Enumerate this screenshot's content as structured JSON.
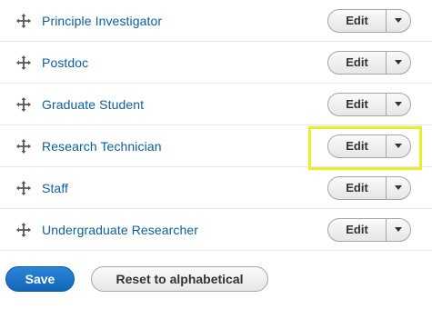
{
  "terms": [
    {
      "label": "Principle Investigator",
      "edit_label": "Edit"
    },
    {
      "label": "Postdoc",
      "edit_label": "Edit"
    },
    {
      "label": "Graduate Student",
      "edit_label": "Edit"
    },
    {
      "label": "Research Technician",
      "edit_label": "Edit"
    },
    {
      "label": "Staff",
      "edit_label": "Edit"
    },
    {
      "label": "Undergraduate Researcher",
      "edit_label": "Edit"
    }
  ],
  "highlighted_term_index": 3,
  "colors": {
    "link": "#0e5d9e",
    "primary_button": "#1367b8",
    "highlight": "#eaf028"
  },
  "icons": {
    "drag": "move-arrows-icon",
    "dropdown": "caret-down-icon"
  },
  "actions": {
    "save_label": "Save",
    "reset_label": "Reset to alphabetical"
  }
}
